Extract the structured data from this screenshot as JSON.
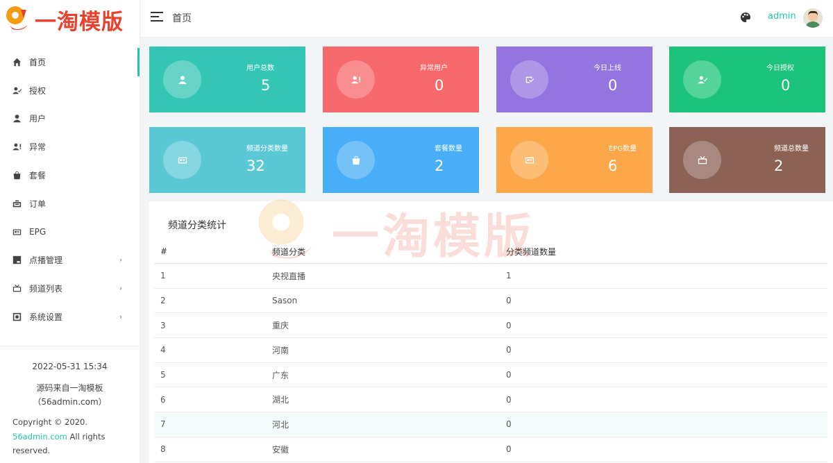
{
  "brand": {
    "name": "一淘模版",
    "color": "#e8422f"
  },
  "header": {
    "title": "首页",
    "user": "admin"
  },
  "sidebar": {
    "items": [
      {
        "label": "首页",
        "icon": "home-icon",
        "active": true
      },
      {
        "label": "授权",
        "icon": "user-check-icon"
      },
      {
        "label": "用户",
        "icon": "user-icon"
      },
      {
        "label": "异常",
        "icon": "user-alert-icon"
      },
      {
        "label": "套餐",
        "icon": "bag-icon"
      },
      {
        "label": "订单",
        "icon": "briefcase-icon"
      },
      {
        "label": "EPG",
        "icon": "card-icon"
      },
      {
        "label": "点播管理",
        "icon": "js-icon",
        "arrow": "›"
      },
      {
        "label": "频道列表",
        "icon": "tv-icon",
        "arrow": "›"
      },
      {
        "label": "系统设置",
        "icon": "settings-icon",
        "arrow": "›"
      }
    ],
    "datetime": "2022-05-31 15:34",
    "source_line1": "源码来自一淘模板",
    "source_line2": "（56admin.com）",
    "copyright_prefix": "Copyright © 2020.",
    "copyright_link": "56admin.com",
    "copyright_suffix": " All rights reserved."
  },
  "cards": [
    {
      "label": "用户总数",
      "value": "5",
      "color": "#34c6b4",
      "icon": "user-icon"
    },
    {
      "label": "异常用户",
      "value": "0",
      "color": "#f7696b",
      "icon": "user-alert-icon"
    },
    {
      "label": "今日上线",
      "value": "0",
      "color": "#9475e0",
      "icon": "login-icon"
    },
    {
      "label": "今日授权",
      "value": "0",
      "color": "#1bc47a",
      "icon": "user-check-icon"
    },
    {
      "label": "频道分类数量",
      "value": "32",
      "color": "#5bc8d6",
      "icon": "card-icon"
    },
    {
      "label": "套餐数量",
      "value": "2",
      "color": "#47aef7",
      "icon": "bag-icon"
    },
    {
      "label": "EPG数量",
      "value": "6",
      "color": "#fba74a",
      "icon": "card-icon"
    },
    {
      "label": "频道总数量",
      "value": "2",
      "color": "#8c6254",
      "icon": "tv-icon"
    }
  ],
  "table": {
    "title": "频道分类统计",
    "columns": [
      "#",
      "频道分类",
      "分类频道数量"
    ],
    "rows": [
      [
        "1",
        "央视直播",
        "1"
      ],
      [
        "2",
        "Sason",
        "0"
      ],
      [
        "3",
        "重庆",
        "0"
      ],
      [
        "4",
        "河南",
        "0"
      ],
      [
        "5",
        "广东",
        "0"
      ],
      [
        "6",
        "湖北",
        "0"
      ],
      [
        "7",
        "河北",
        "0"
      ],
      [
        "8",
        "安徽",
        "0"
      ]
    ]
  },
  "colors": {
    "accent": "#1fc6a8"
  }
}
